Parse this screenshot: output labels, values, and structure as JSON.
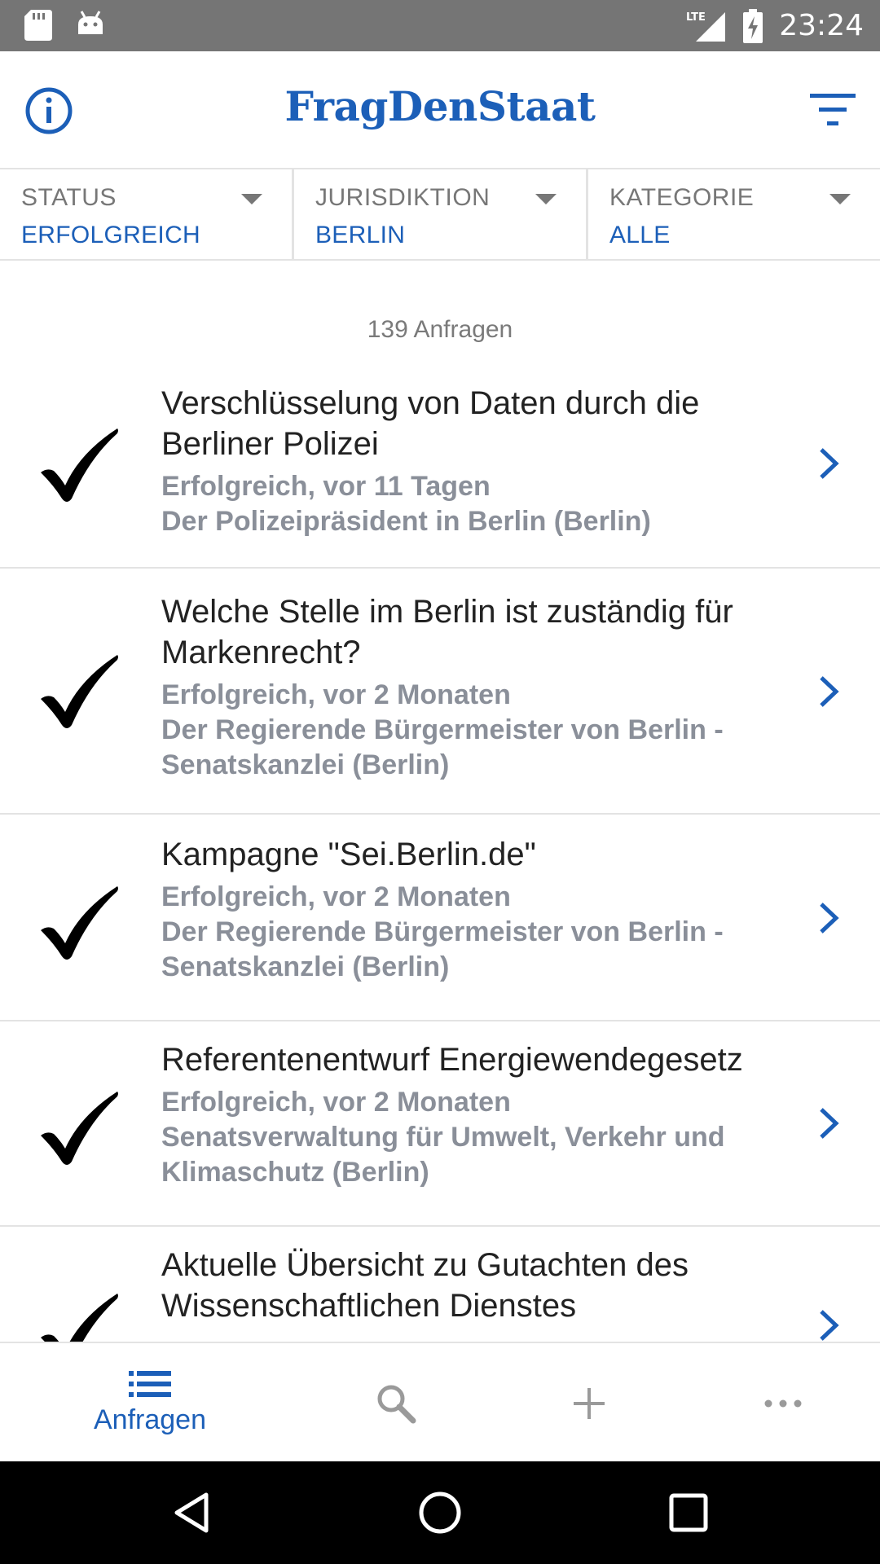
{
  "status_bar": {
    "time": "23:24",
    "network": "LTE"
  },
  "app_bar": {
    "title": "FragDenStaat"
  },
  "filters": [
    {
      "label": "STATUS",
      "value": "ERFOLGREICH"
    },
    {
      "label": "JURISDIKTION",
      "value": "BERLIN"
    },
    {
      "label": "KATEGORIE",
      "value": "ALLE"
    }
  ],
  "results": {
    "count_text": "139 Anfragen"
  },
  "requests": [
    {
      "title_lines": [
        "Verschlüsselung von Daten durch die",
        "Berliner Polizei"
      ],
      "meta_lines": [
        "Erfolgreich, vor 11 Tagen",
        "Der Polizeipräsident in Berlin (Berlin)"
      ]
    },
    {
      "title_lines": [
        "Welche Stelle im Berlin ist zuständig für",
        "Markenrecht?"
      ],
      "meta_lines": [
        "Erfolgreich, vor 2 Monaten",
        "Der Regierende Bürgermeister von Berlin -",
        "Senatskanzlei (Berlin)"
      ]
    },
    {
      "title_lines": [
        "Kampagne \"Sei.Berlin.de\""
      ],
      "meta_lines": [
        "Erfolgreich, vor 2 Monaten",
        "Der Regierende Bürgermeister von Berlin -",
        "Senatskanzlei (Berlin)"
      ]
    },
    {
      "title_lines": [
        "Referentenentwurf Energiewendegesetz"
      ],
      "meta_lines": [
        "Erfolgreich, vor 2 Monaten",
        "Senatsverwaltung für Umwelt, Verkehr und",
        "Klimaschutz (Berlin)"
      ]
    },
    {
      "title_lines": [
        "Aktuelle Übersicht zu Gutachten des",
        "Wissenschaftlichen Dienstes"
      ],
      "meta_lines": []
    }
  ],
  "bottom_nav": {
    "requests_label": "Anfragen"
  },
  "colors": {
    "accent": "#1c5fb8",
    "meta_text": "#8a8f99",
    "status_bar": "#757575"
  }
}
